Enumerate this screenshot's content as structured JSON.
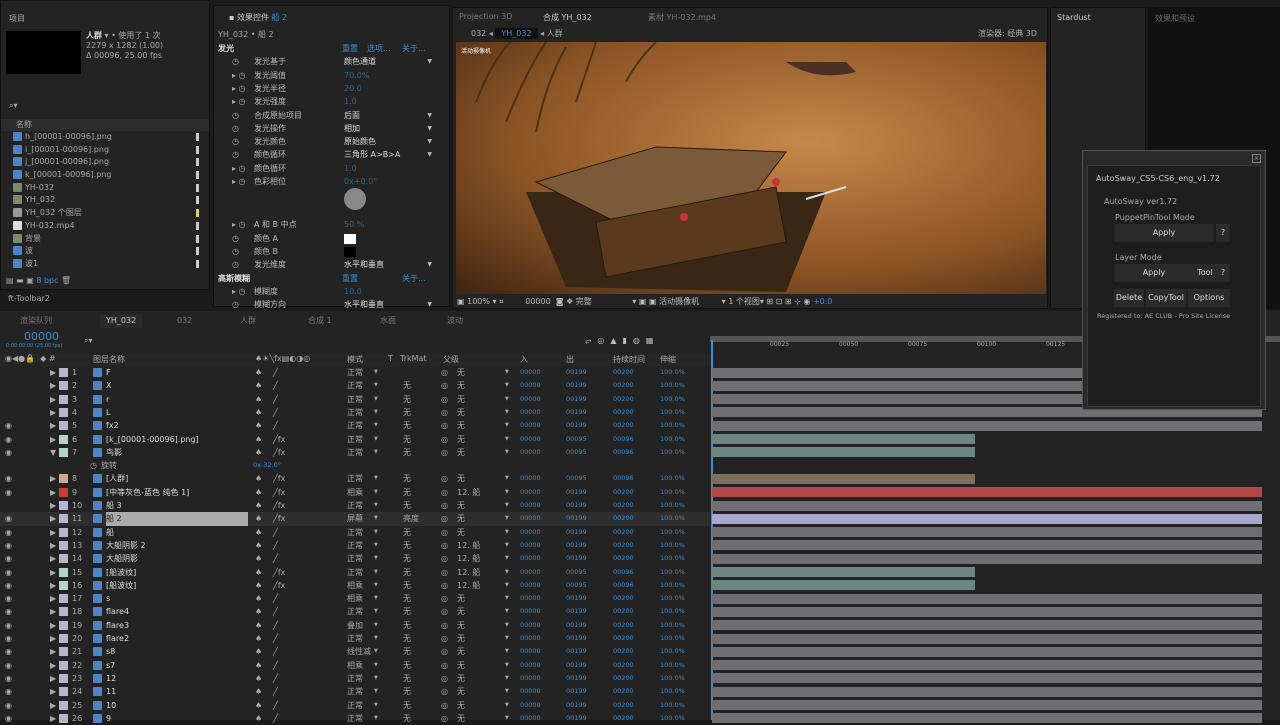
{
  "project": {
    "title": "项目",
    "item_name": "人群",
    "usage": "使用了 1 次",
    "dims": "2279 x 1282 (1.00)",
    "duration": "Δ 00096, 25.00 fps",
    "col_name": "名称",
    "bpc": "8 bpc",
    "items": [
      {
        "name": "h_[00001-00096].png",
        "type": "seq"
      },
      {
        "name": "i_[00001-00096].png",
        "type": "seq"
      },
      {
        "name": "j_[00001-00096].png",
        "type": "seq"
      },
      {
        "name": "k_[00001-00096].png",
        "type": "seq"
      },
      {
        "name": "YH-032",
        "type": "comp"
      },
      {
        "name": "YH_032",
        "type": "comp"
      },
      {
        "name": "YH_032 个图层",
        "type": "folder"
      },
      {
        "name": "YH-032.mp4",
        "type": "file"
      },
      {
        "name": "背景",
        "type": "comp"
      },
      {
        "name": "波",
        "type": "seq"
      },
      {
        "name": "波1",
        "type": "seq"
      }
    ]
  },
  "toolbar2": "ft-Toolbar2",
  "effects": {
    "title": "效果控件",
    "layer": "船 2",
    "path": "YH_032 • 船 2",
    "reset": "重置",
    "options": "选项...",
    "about": "关于...",
    "fx1": "发光",
    "fx2": "高斯模糊",
    "props": [
      {
        "n": "发光基于",
        "v": "颜色通道",
        "dd": true
      },
      {
        "n": "发光阈值",
        "v": "70.0%",
        "t": true
      },
      {
        "n": "发光半径",
        "v": "20.0",
        "t": true
      },
      {
        "n": "发光强度",
        "v": "1.0",
        "t": true
      },
      {
        "n": "合成原始项目",
        "v": "后面",
        "dd": true
      },
      {
        "n": "发光操作",
        "v": "相加",
        "dd": true
      },
      {
        "n": "发光颜色",
        "v": "原始颜色",
        "dd": true
      },
      {
        "n": "颜色循环",
        "v": "三角形 A>B>A",
        "dd": true
      },
      {
        "n": "颜色循环",
        "v": "1.0",
        "t": true
      },
      {
        "n": "色彩相位",
        "v": "0x+0.0°",
        "t": true,
        "open": true
      }
    ],
    "props2": [
      {
        "n": "A 和 B 中点",
        "v": "50 %",
        "t": true
      },
      {
        "n": "颜色 A",
        "v": "",
        "color": "#ffffff"
      },
      {
        "n": "颜色 B",
        "v": "",
        "color": "#000000"
      },
      {
        "n": "发光维度",
        "v": "水平和垂直",
        "dd": true
      }
    ],
    "blur": [
      {
        "n": "模糊度",
        "v": "10.0",
        "t": true
      },
      {
        "n": "模糊方向",
        "v": "水平和垂直",
        "dd": true
      }
    ]
  },
  "viewer": {
    "tabs": [
      "Projection 3D",
      "合成 YH_032",
      "素材 YH-032.mp4"
    ],
    "crumbs": [
      "032",
      "YH_032",
      "人群"
    ],
    "renderer": "渲染器:",
    "renderer_val": "经典 3D",
    "camera_label": "活动摄像机",
    "footer": {
      "zoom": "100%",
      "time": "00000",
      "quality": "完整",
      "camera": "活动摄像机",
      "views": "1 个视图",
      "exposure": "+0.0"
    }
  },
  "stardust": "Stardust",
  "presets": "效果和预设",
  "autosway": {
    "title": "AutoSway_CS5-CS6_eng_v1.72",
    "ver": "AutoSway ver1.72",
    "puppet": "PuppetPinTool Mode",
    "apply": "Apply",
    "help": "?",
    "layer_mode": "Layer Mode",
    "tool": "Tool",
    "delete": "Delete",
    "copytool": "CopyTool",
    "options": "Options",
    "reg": "Registered to: AE CLUB - Pro Site License"
  },
  "timeline": {
    "tabs": [
      "渲染队列",
      "YH_032",
      "032",
      "人群",
      "合成 1",
      "水面",
      "波动"
    ],
    "timecode": "00000",
    "timecode_sub": "0:00:00:00 (25.00 fps)",
    "cols": {
      "name": "图层名称",
      "mode": "模式",
      "t": "T",
      "trkmat": "TrkMat",
      "parent": "父级",
      "in": "入",
      "out": "出",
      "dur": "持续时间",
      "stretch": "伸缩"
    },
    "ruler": [
      "00025",
      "00050",
      "00075",
      "00100",
      "00125"
    ],
    "sub_prop": {
      "name": "旋转",
      "value": "0x-32.0°"
    },
    "layers": [
      {
        "n": 1,
        "name": "F",
        "c": "#b9b3d6",
        "mode": "正常",
        "tm": "",
        "p": "无",
        "in": "00000",
        "out": "00199",
        "d": "00200",
        "s": "100.0%",
        "fx": false,
        "eye": false
      },
      {
        "n": 2,
        "name": "X",
        "c": "#b9b3d6",
        "mode": "正常",
        "tm": "无",
        "p": "无",
        "in": "00000",
        "out": "00199",
        "d": "00200",
        "s": "100.0%",
        "fx": false,
        "eye": false
      },
      {
        "n": 3,
        "name": "r",
        "c": "#b9b3d6",
        "mode": "正常",
        "tm": "无",
        "p": "无",
        "in": "00000",
        "out": "00199",
        "d": "00200",
        "s": "100.0%",
        "fx": false,
        "eye": false
      },
      {
        "n": 4,
        "name": "L",
        "c": "#b9b3d6",
        "mode": "正常",
        "tm": "无",
        "p": "无",
        "in": "00000",
        "out": "00199",
        "d": "00200",
        "s": "100.0%",
        "fx": false,
        "eye": false
      },
      {
        "n": 5,
        "name": "fx2",
        "c": "#b9b3d6",
        "mode": "正常",
        "tm": "无",
        "p": "无",
        "in": "00000",
        "out": "00199",
        "d": "00200",
        "s": "100.0%",
        "fx": false,
        "eye": true
      },
      {
        "n": 6,
        "name": "[k_[00001-00096].png]",
        "c": "#b4d6c8",
        "mode": "正常",
        "tm": "无",
        "p": "无",
        "in": "00000",
        "out": "00095",
        "d": "00096",
        "s": "100.0%",
        "fx": true,
        "eye": true
      },
      {
        "n": 7,
        "name": "鸟影",
        "c": "#b4d6c8",
        "mode": "正常",
        "tm": "无",
        "p": "无",
        "in": "00000",
        "out": "00095",
        "d": "00096",
        "s": "100.0%",
        "fx": true,
        "eye": true,
        "open": true
      },
      {
        "n": 8,
        "name": "[人群]",
        "c": "#c8ac8c",
        "mode": "正常",
        "tm": "无",
        "p": "无",
        "in": "00000",
        "out": "00095",
        "d": "00096",
        "s": "100.0%",
        "fx": true,
        "eye": true
      },
      {
        "n": 9,
        "name": "[中等灰色-蓝色 纯色 1]",
        "c": "#d23a3a",
        "mode": "相乘",
        "tm": "无",
        "p": "12. 船",
        "in": "00000",
        "out": "00199",
        "d": "00200",
        "s": "100.0%",
        "fx": true,
        "eye": true
      },
      {
        "n": 10,
        "name": "船 3",
        "c": "#b9b3d6",
        "mode": "正常",
        "tm": "无",
        "p": "无",
        "in": "00000",
        "out": "00199",
        "d": "00200",
        "s": "100.0%",
        "fx": true,
        "eye": false
      },
      {
        "n": 11,
        "name": "船 2",
        "c": "#b9b3d6",
        "mode": "屏幕",
        "tm": "亮度",
        "p": "无",
        "in": "00000",
        "out": "00199",
        "d": "00200",
        "s": "100.0%",
        "fx": true,
        "eye": true,
        "sel": true
      },
      {
        "n": 12,
        "name": "船",
        "c": "#b9b3d6",
        "mode": "正常",
        "tm": "无",
        "p": "无",
        "in": "00000",
        "out": "00199",
        "d": "00200",
        "s": "100.0%",
        "fx": false,
        "eye": true
      },
      {
        "n": 13,
        "name": "大船阴影 2",
        "c": "#b9b3d6",
        "mode": "正常",
        "tm": "无",
        "p": "12. 船",
        "in": "00000",
        "out": "00199",
        "d": "00200",
        "s": "100.0%",
        "fx": false,
        "eye": true
      },
      {
        "n": 14,
        "name": "大船阴影",
        "c": "#b9b3d6",
        "mode": "正常",
        "tm": "无",
        "p": "12. 船",
        "in": "00000",
        "out": "00199",
        "d": "00200",
        "s": "100.0%",
        "fx": false,
        "eye": true
      },
      {
        "n": 15,
        "name": "[船波纹]",
        "c": "#b4d6c8",
        "mode": "正常",
        "tm": "无",
        "p": "12. 船",
        "in": "00000",
        "out": "00095",
        "d": "00096",
        "s": "100.0%",
        "fx": true,
        "eye": true
      },
      {
        "n": 16,
        "name": "[船波纹]",
        "c": "#b4d6c8",
        "mode": "相乘",
        "tm": "无",
        "p": "12. 船",
        "in": "00000",
        "out": "00095",
        "d": "00096",
        "s": "100.0%",
        "fx": true,
        "eye": true
      },
      {
        "n": 17,
        "name": "s",
        "c": "#b9b3d6",
        "mode": "相乘",
        "tm": "无",
        "p": "无",
        "in": "00000",
        "out": "00199",
        "d": "00200",
        "s": "100.0%",
        "fx": false,
        "eye": true
      },
      {
        "n": 18,
        "name": "flare4",
        "c": "#b9b3d6",
        "mode": "正常",
        "tm": "无",
        "p": "无",
        "in": "00000",
        "out": "00199",
        "d": "00200",
        "s": "100.0%",
        "fx": false,
        "eye": true
      },
      {
        "n": 19,
        "name": "flare3",
        "c": "#b9b3d6",
        "mode": "叠加",
        "tm": "无",
        "p": "无",
        "in": "00000",
        "out": "00199",
        "d": "00200",
        "s": "100.0%",
        "fx": false,
        "eye": true
      },
      {
        "n": 20,
        "name": "flare2",
        "c": "#b9b3d6",
        "mode": "正常",
        "tm": "无",
        "p": "无",
        "in": "00000",
        "out": "00199",
        "d": "00200",
        "s": "100.0%",
        "fx": false,
        "eye": true
      },
      {
        "n": 21,
        "name": "s8",
        "c": "#b9b3d6",
        "mode": "线性减",
        "tm": "无",
        "p": "无",
        "in": "00000",
        "out": "00199",
        "d": "00200",
        "s": "100.0%",
        "fx": false,
        "eye": true
      },
      {
        "n": 22,
        "name": "s7",
        "c": "#b9b3d6",
        "mode": "相乘",
        "tm": "无",
        "p": "无",
        "in": "00000",
        "out": "00199",
        "d": "00200",
        "s": "100.0%",
        "fx": false,
        "eye": true
      },
      {
        "n": 23,
        "name": "12",
        "c": "#b9b3d6",
        "mode": "正常",
        "tm": "无",
        "p": "无",
        "in": "00000",
        "out": "00199",
        "d": "00200",
        "s": "100.0%",
        "fx": false,
        "eye": true
      },
      {
        "n": 24,
        "name": "11",
        "c": "#b9b3d6",
        "mode": "正常",
        "tm": "无",
        "p": "无",
        "in": "00000",
        "out": "00199",
        "d": "00200",
        "s": "100.0%",
        "fx": false,
        "eye": true
      },
      {
        "n": 25,
        "name": "10",
        "c": "#b9b3d6",
        "mode": "正常",
        "tm": "无",
        "p": "无",
        "in": "00000",
        "out": "00199",
        "d": "00200",
        "s": "100.0%",
        "fx": false,
        "eye": true
      },
      {
        "n": 26,
        "name": "9",
        "c": "#b9b3d6",
        "mode": "正常",
        "tm": "无",
        "p": "无",
        "in": "00000",
        "out": "00199",
        "d": "00200",
        "s": "100.0%",
        "fx": false,
        "eye": true
      }
    ]
  }
}
